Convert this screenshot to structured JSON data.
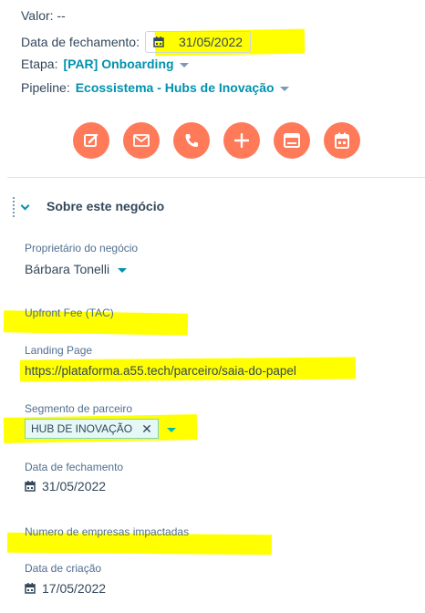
{
  "summary": {
    "valor": "Valor: --",
    "close_date_label": "Data de fechamento:",
    "close_date_value": "31/05/2022",
    "stage_label": "Etapa:",
    "stage_value": "[PAR] Onboarding",
    "pipeline_label": "Pipeline:",
    "pipeline_value": "Ecossistema - Hubs de Inovação"
  },
  "actions": [
    {
      "icon": "note-icon"
    },
    {
      "icon": "email-icon"
    },
    {
      "icon": "phone-icon"
    },
    {
      "icon": "plus-icon"
    },
    {
      "icon": "log-activity-icon"
    },
    {
      "icon": "meeting-calendar-icon"
    }
  ],
  "section": {
    "title": "Sobre este negócio"
  },
  "properties": {
    "owner_label": "Proprietário do negócio",
    "owner_value": "Bárbara Tonelli",
    "upfront_label": "Upfront Fee (TAC)",
    "landing_label": "Landing Page",
    "landing_value": "https://plataforma.a55.tech/parceiro/saia-do-papel",
    "segment_label": "Segmento de parceiro",
    "segment_tag": "HUB DE INOVAÇÃO",
    "close_label": "Data de fechamento",
    "close_value": "31/05/2022",
    "companies_label": "Numero de empresas impactadas",
    "created_label": "Data de criação",
    "created_value": "17/05/2022"
  },
  "colors": {
    "accent": "#ff7a59",
    "link": "#0091ae",
    "highlight": "#ffff00",
    "text": "#33475b"
  }
}
